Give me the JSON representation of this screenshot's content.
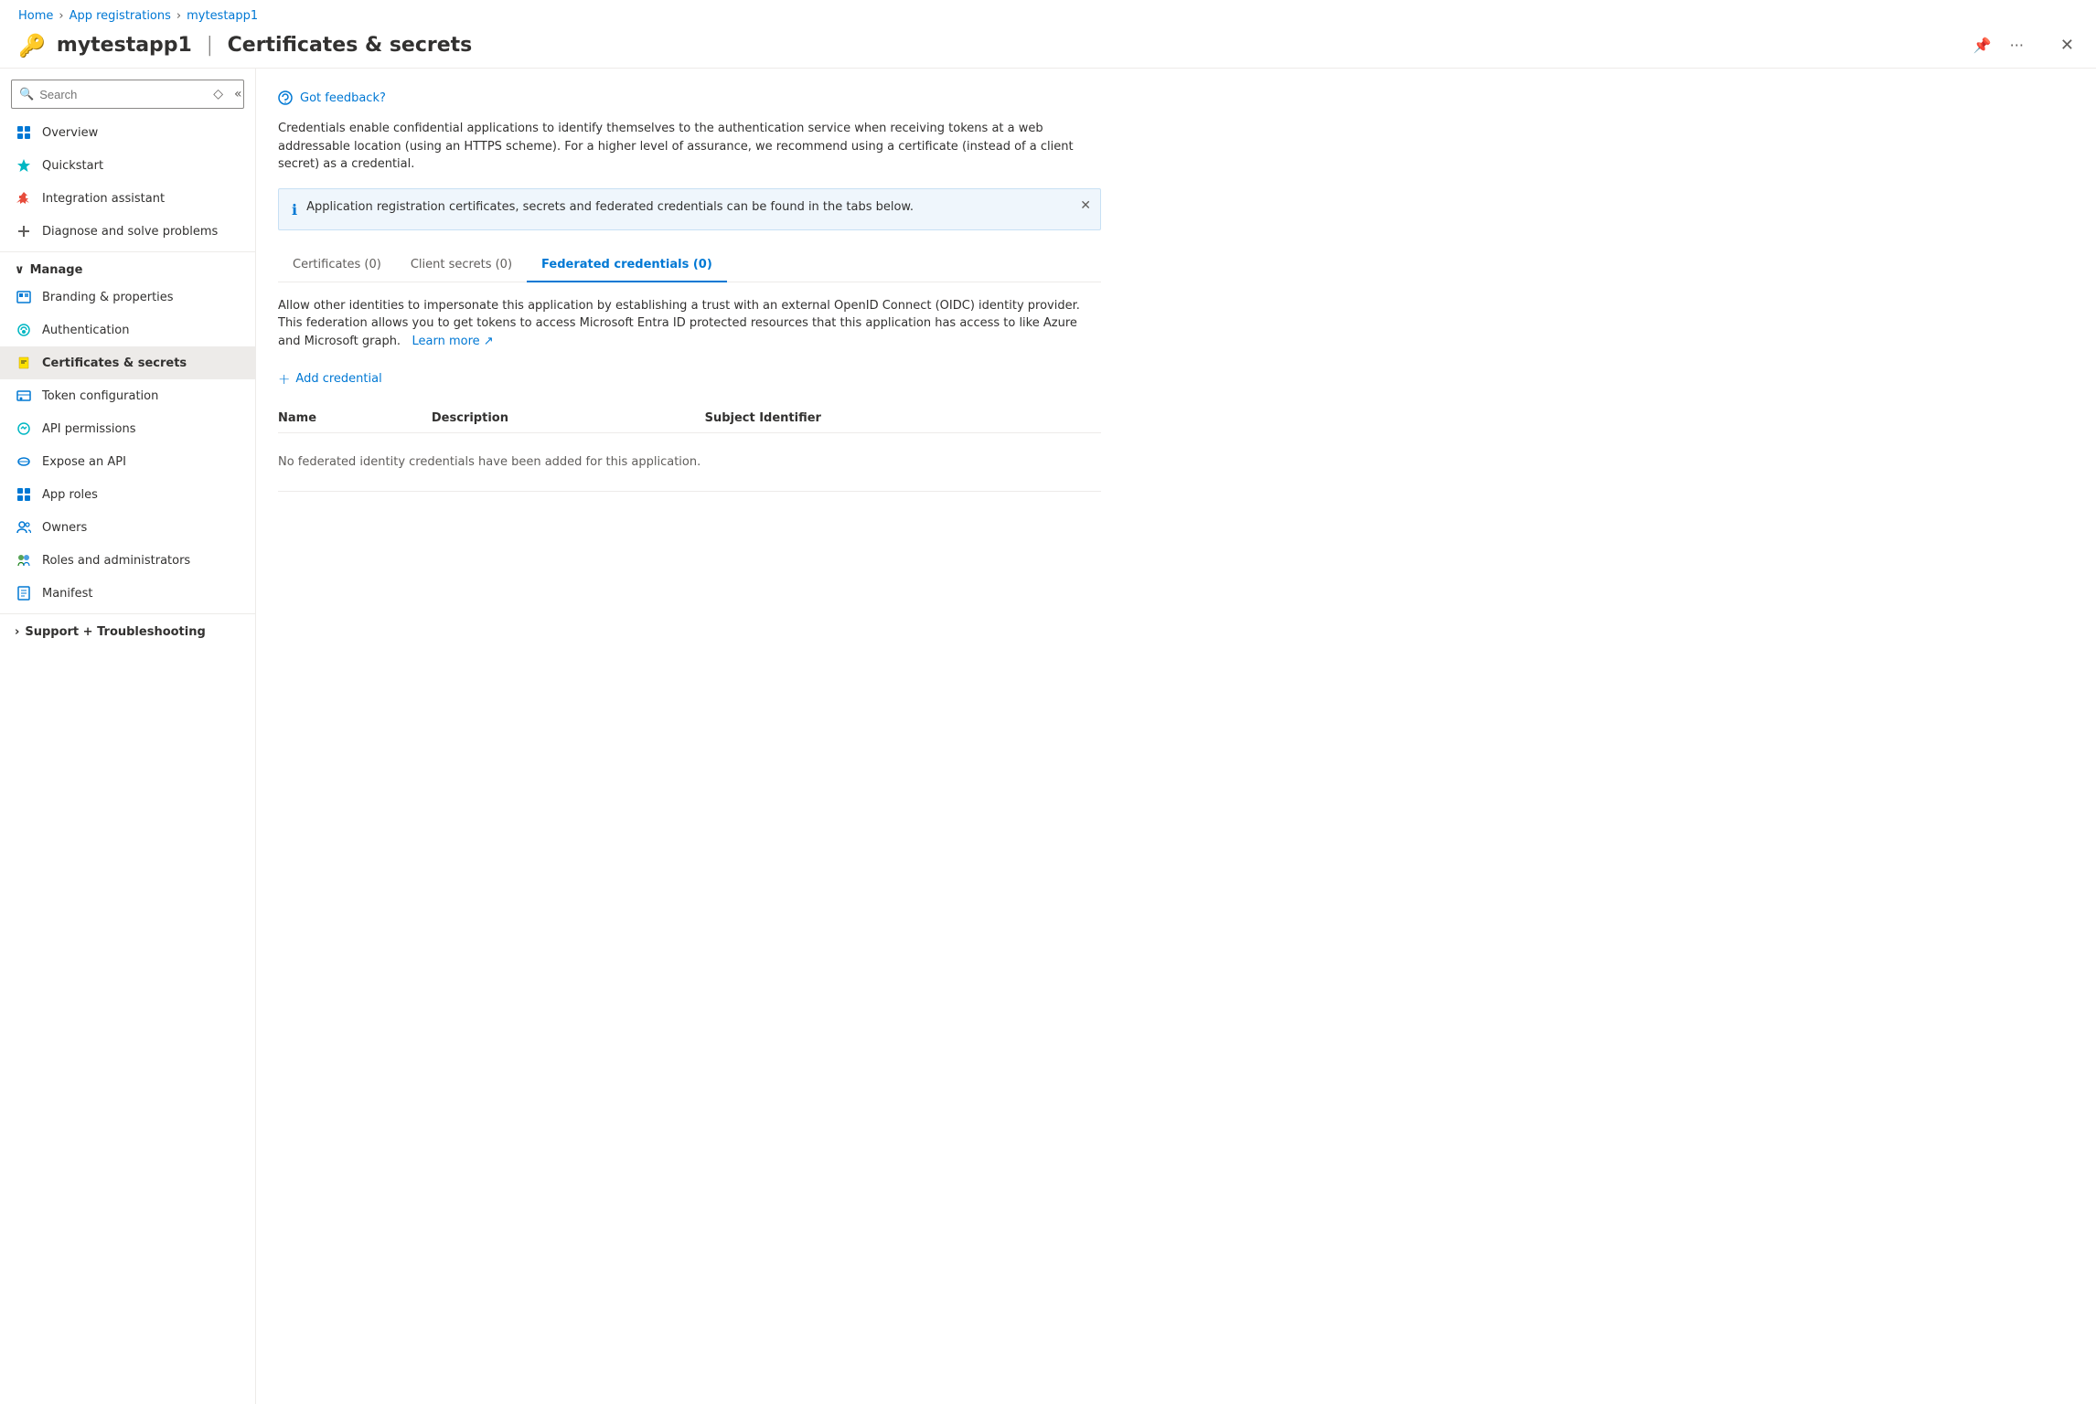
{
  "breadcrumb": {
    "home": "Home",
    "app_registrations": "App registrations",
    "app_name": "mytestapp1"
  },
  "header": {
    "icon": "🔑",
    "app_name": "mytestapp1",
    "separator": "|",
    "page_title": "Certificates & secrets",
    "pin_label": "Pin",
    "more_label": "...",
    "close_label": "✕"
  },
  "sidebar": {
    "search_placeholder": "Search",
    "items": [
      {
        "id": "overview",
        "label": "Overview",
        "icon": "grid"
      },
      {
        "id": "quickstart",
        "label": "Quickstart",
        "icon": "quickstart"
      },
      {
        "id": "integration-assistant",
        "label": "Integration assistant",
        "icon": "rocket"
      },
      {
        "id": "diagnose",
        "label": "Diagnose and solve problems",
        "icon": "cross"
      }
    ],
    "manage_section": "Manage",
    "manage_items": [
      {
        "id": "branding",
        "label": "Branding & properties",
        "icon": "branding"
      },
      {
        "id": "authentication",
        "label": "Authentication",
        "icon": "auth"
      },
      {
        "id": "certificates",
        "label": "Certificates & secrets",
        "icon": "key",
        "active": true
      },
      {
        "id": "token-config",
        "label": "Token configuration",
        "icon": "token"
      },
      {
        "id": "api-permissions",
        "label": "API permissions",
        "icon": "api"
      },
      {
        "id": "expose-api",
        "label": "Expose an API",
        "icon": "cloud"
      },
      {
        "id": "app-roles",
        "label": "App roles",
        "icon": "approles"
      },
      {
        "id": "owners",
        "label": "Owners",
        "icon": "owners"
      },
      {
        "id": "roles-admins",
        "label": "Roles and administrators",
        "icon": "roles"
      },
      {
        "id": "manifest",
        "label": "Manifest",
        "icon": "manifest"
      }
    ],
    "support_section": "Support + Troubleshooting"
  },
  "feedback": {
    "icon": "💬",
    "label": "Got feedback?"
  },
  "description": "Credentials enable confidential applications to identify themselves to the authentication service when receiving tokens at a web addressable location (using an HTTPS scheme). For a higher level of assurance, we recommend using a certificate (instead of a client secret) as a credential.",
  "info_banner": {
    "text": "Application registration certificates, secrets and federated credentials can be found in the tabs below."
  },
  "tabs": [
    {
      "id": "certificates",
      "label": "Certificates (0)",
      "active": false
    },
    {
      "id": "client-secrets",
      "label": "Client secrets (0)",
      "active": false
    },
    {
      "id": "federated-credentials",
      "label": "Federated credentials (0)",
      "active": true
    }
  ],
  "federated_tab": {
    "description": "Allow other identities to impersonate this application by establishing a trust with an external OpenID Connect (OIDC) identity provider. This federation allows you to get tokens to access Microsoft Entra ID protected resources that this application has access to like Azure and Microsoft graph.",
    "learn_more": "Learn more",
    "add_credential": "Add credential",
    "table_headers": [
      "Name",
      "Description",
      "Subject Identifier"
    ],
    "empty_message": "No federated identity credentials have been added for this application."
  }
}
